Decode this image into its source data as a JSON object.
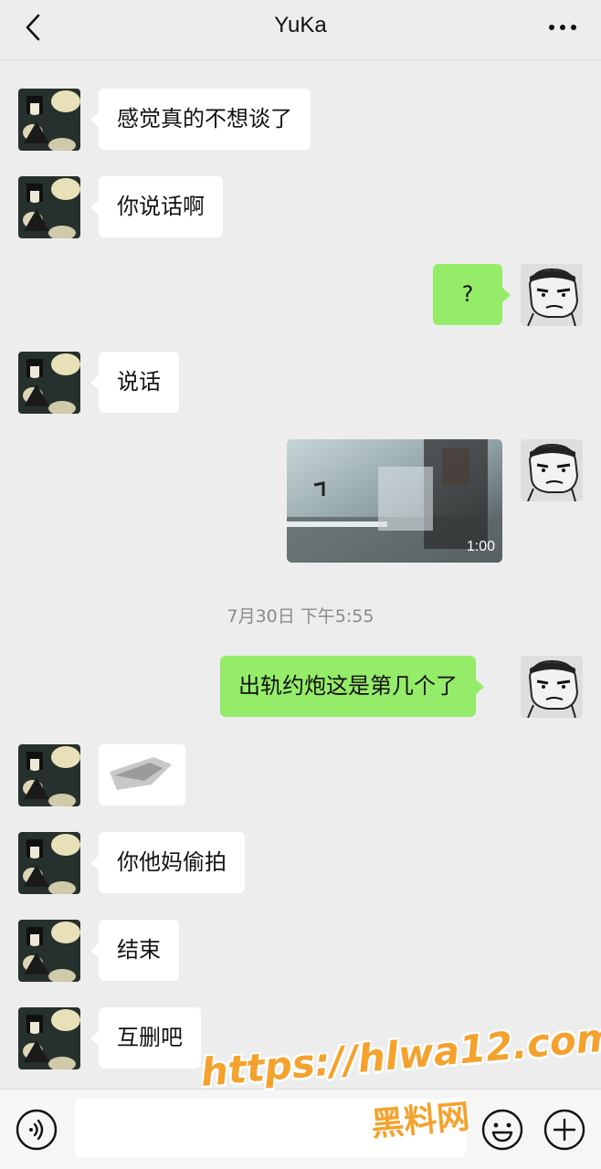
{
  "header": {
    "title": "YuKa",
    "back_icon": "chevron-left-icon",
    "more_icon": "more-dots-icon"
  },
  "messages": [
    {
      "type": "text",
      "side": "left",
      "text": "感觉真的不想谈了"
    },
    {
      "type": "text",
      "side": "left",
      "text": "你说话啊"
    },
    {
      "type": "text",
      "side": "right",
      "text": "?"
    },
    {
      "type": "text",
      "side": "left",
      "text": "说话"
    },
    {
      "type": "video",
      "side": "right",
      "duration": "1:00"
    },
    {
      "type": "timestamp",
      "text": "7月30日 下午5:55"
    },
    {
      "type": "text",
      "side": "right",
      "text": "出轨约炮这是第几个了"
    },
    {
      "type": "sticker",
      "side": "left"
    },
    {
      "type": "text",
      "side": "left",
      "text": "你他妈偷拍"
    },
    {
      "type": "text",
      "side": "left",
      "text": "结束"
    },
    {
      "type": "text",
      "side": "left",
      "text": "互删吧"
    }
  ],
  "input_bar": {
    "voice_icon": "voice-icon",
    "text_value": "",
    "emoji_icon": "emoji-icon",
    "plus_icon": "plus-icon"
  },
  "watermark": {
    "url": "https://hlwa12.com",
    "name": "黑料网"
  },
  "colors": {
    "background": "#ededed",
    "incoming_bubble": "#ffffff",
    "outgoing_bubble": "#95ec69",
    "watermark": "#f4a22d"
  }
}
